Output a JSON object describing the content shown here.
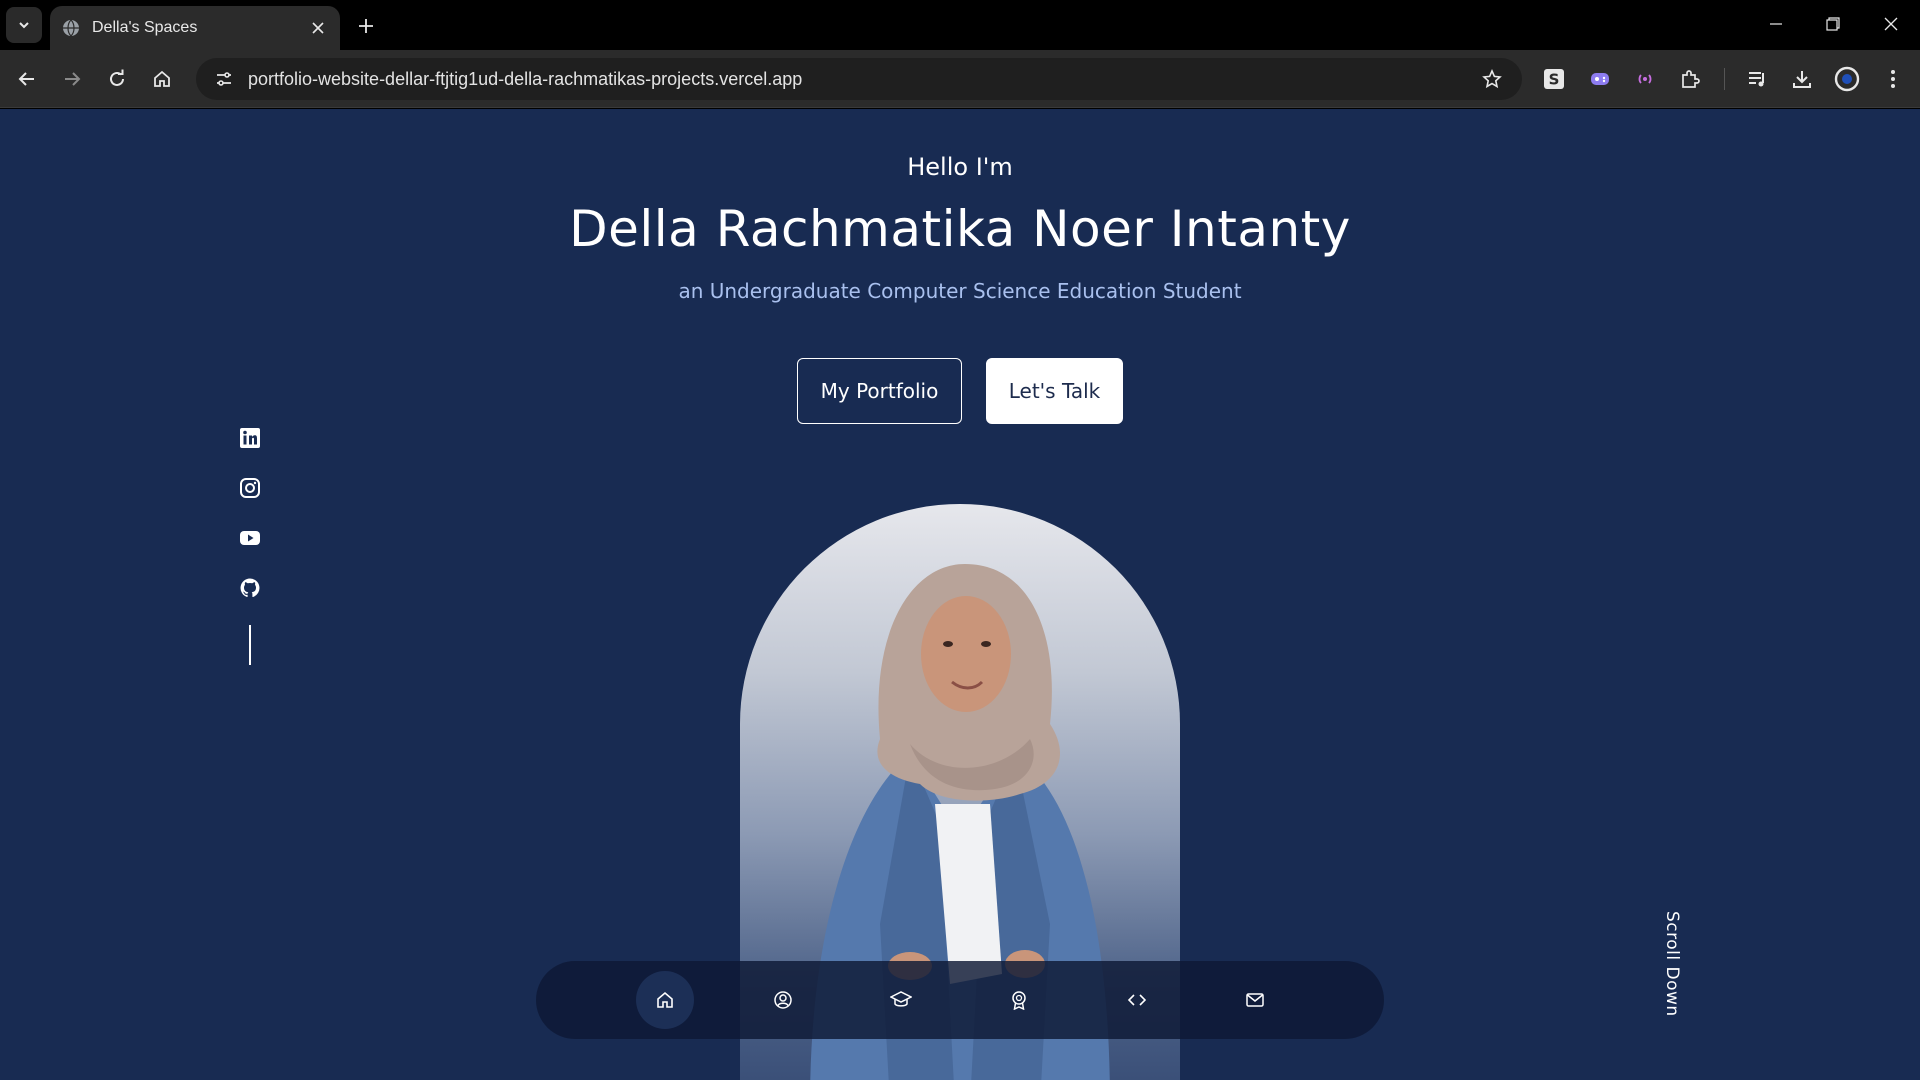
{
  "browser": {
    "tab": {
      "title": "Della's Spaces"
    },
    "url": "portfolio-website-dellar-ftjtig1ud-della-rachmatikas-projects.vercel.app",
    "extensions": [
      "s-extension-icon",
      "gamepad-extension-icon",
      "broadcast-extension-icon",
      "puzzle-extensions-icon"
    ],
    "toolbar_icons": [
      "media-queue-icon",
      "download-icon",
      "profile-icon",
      "menu-icon"
    ]
  },
  "hero": {
    "greeting": "Hello I'm",
    "name": "Della Rachmatika Noer Intanty",
    "role": "an Undergraduate Computer Science Education Student",
    "primary_button": "My Portfolio",
    "secondary_button": "Let's Talk"
  },
  "socials": [
    "linkedin-icon",
    "instagram-icon",
    "youtube-icon",
    "github-icon"
  ],
  "scroll_hint": "Scroll Down",
  "bottom_nav": {
    "items": [
      "home-icon",
      "user-icon",
      "education-icon",
      "award-icon",
      "code-icon",
      "mail-icon"
    ],
    "active": "home-icon"
  },
  "colors": {
    "page_bg": "#182b52",
    "role_text": "#a9c0ee",
    "nav_bg": "#0d1934"
  }
}
